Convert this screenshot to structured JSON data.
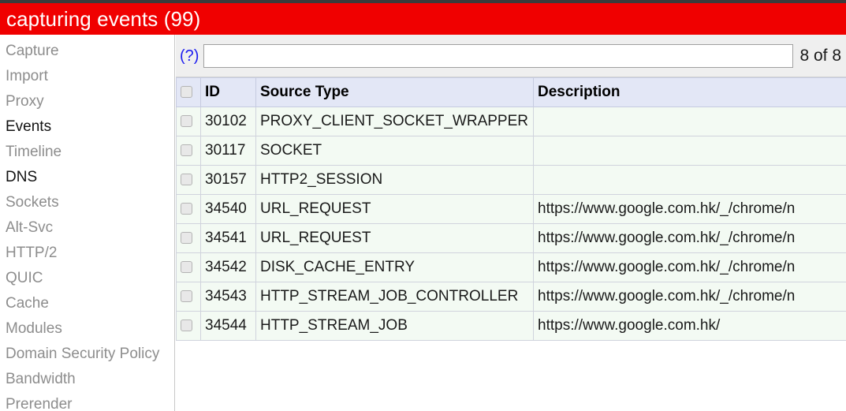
{
  "banner": {
    "title": "capturing events (99)",
    "background_color": "#f00000",
    "text_color": "#ffffff"
  },
  "sidebar": {
    "items": [
      {
        "label": "Capture",
        "active": false
      },
      {
        "label": "Import",
        "active": false
      },
      {
        "label": "Proxy",
        "active": false
      },
      {
        "label": "Events",
        "active": true
      },
      {
        "label": "Timeline",
        "active": false
      },
      {
        "label": "DNS",
        "active": true
      },
      {
        "label": "Sockets",
        "active": false
      },
      {
        "label": "Alt-Svc",
        "active": false
      },
      {
        "label": "HTTP/2",
        "active": false
      },
      {
        "label": "QUIC",
        "active": false
      },
      {
        "label": "Cache",
        "active": false
      },
      {
        "label": "Modules",
        "active": false
      },
      {
        "label": "Domain Security Policy",
        "active": false
      },
      {
        "label": "Bandwidth",
        "active": false
      },
      {
        "label": "Prerender",
        "active": false
      }
    ]
  },
  "toolbar": {
    "help_label": "(?)",
    "search_value": "",
    "search_placeholder": "",
    "match_count": "8 of 8"
  },
  "table": {
    "columns": [
      "",
      "ID",
      "Source Type",
      "Description"
    ],
    "select_all_checked": false,
    "rows": [
      {
        "checked": false,
        "id": "30102",
        "source_type": "PROXY_CLIENT_SOCKET_WRAPPER",
        "description": "",
        "style": "normal"
      },
      {
        "checked": false,
        "id": "30117",
        "source_type": "SOCKET",
        "description": "",
        "style": "highlight"
      },
      {
        "checked": false,
        "id": "30157",
        "source_type": "HTTP2_SESSION",
        "description": "",
        "style": "normal"
      },
      {
        "checked": false,
        "id": "34540",
        "source_type": "URL_REQUEST",
        "description": "https://www.google.com.hk/_/chrome/n",
        "style": "normal"
      },
      {
        "checked": false,
        "id": "34541",
        "source_type": "URL_REQUEST",
        "description": "https://www.google.com.hk/_/chrome/n",
        "style": "normal"
      },
      {
        "checked": false,
        "id": "34542",
        "source_type": "DISK_CACHE_ENTRY",
        "description": "https://www.google.com.hk/_/chrome/n",
        "style": "dim"
      },
      {
        "checked": false,
        "id": "34543",
        "source_type": "HTTP_STREAM_JOB_CONTROLLER",
        "description": "https://www.google.com.hk/_/chrome/n",
        "style": "normal"
      },
      {
        "checked": false,
        "id": "34544",
        "source_type": "HTTP_STREAM_JOB",
        "description": "https://www.google.com.hk/",
        "style": "normal"
      }
    ]
  },
  "colors": {
    "banner_red": "#f00000",
    "header_blue": "#e3e7f6",
    "row_green": "#f3faf3",
    "highlight_purple": "#a32ca0",
    "dim_grey": "#9a9a9a",
    "link_blue": "#1d1df0",
    "sidebar_inactive": "#8d8d8d",
    "sidebar_active": "#111111"
  }
}
